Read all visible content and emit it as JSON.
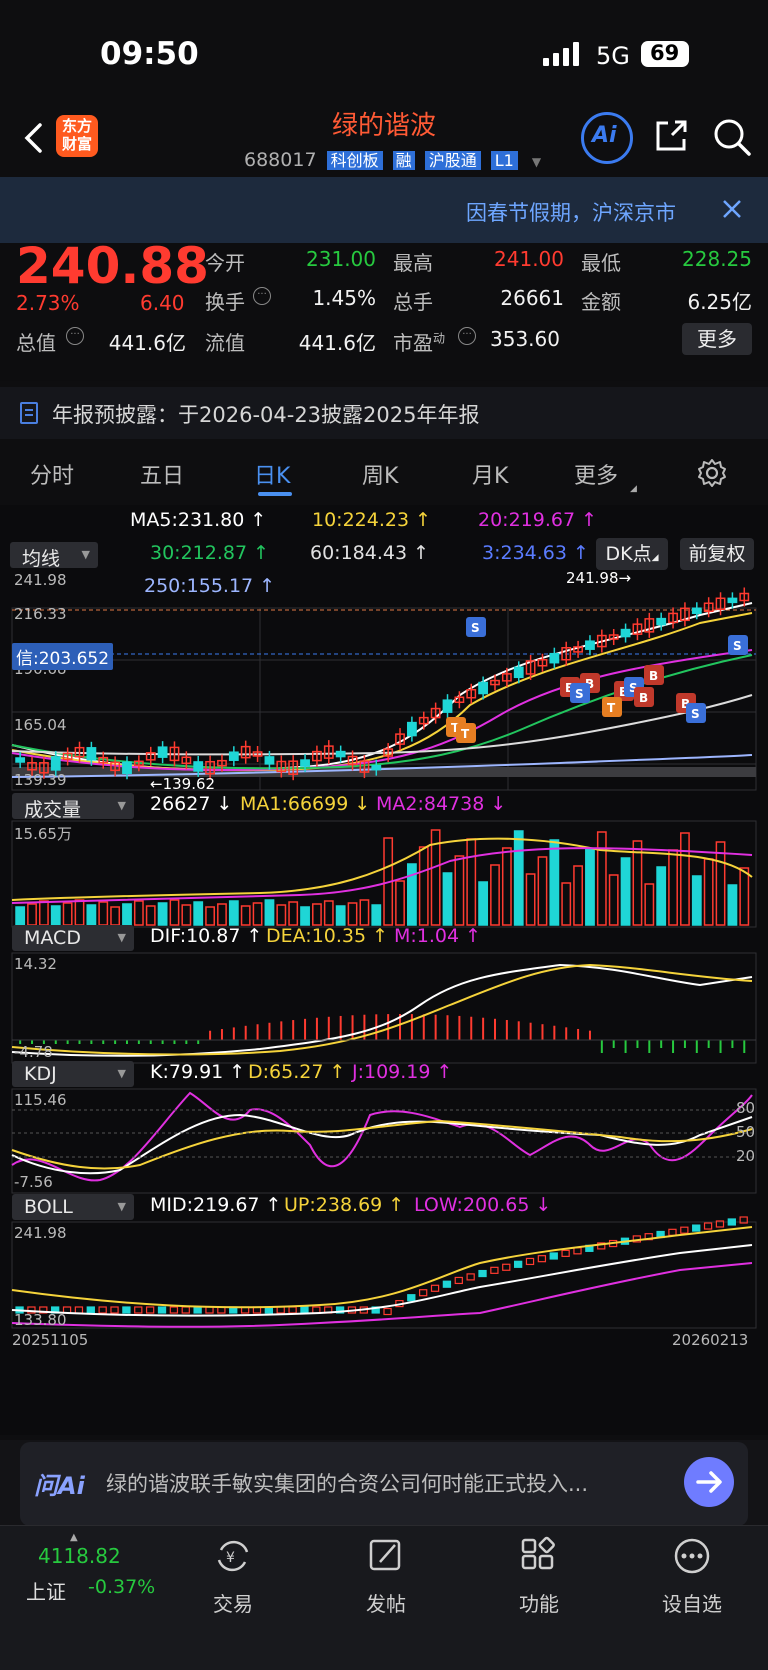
{
  "status": {
    "time": "09:50",
    "network": "5G",
    "battery": "69"
  },
  "header": {
    "logo": "东方财富",
    "title": "绿的谐波",
    "code": "688017",
    "tags": [
      "科创板",
      "融",
      "沪股通",
      "L1"
    ],
    "ai_label": "Ai"
  },
  "banner": {
    "text": "因春节假期，沪深京市"
  },
  "quote": {
    "price": "240.88",
    "change_pct": "2.73%",
    "change": "6.40",
    "open_label": "今开",
    "open": "231.00",
    "high_label": "最高",
    "high": "241.00",
    "low_label": "最低",
    "low": "228.25",
    "turnover_label": "换手",
    "turnover": "1.45%",
    "volume_label": "总手",
    "volume": "26661",
    "amount_label": "金额",
    "amount": "6.25亿",
    "mktcap_label": "总值",
    "mktcap": "441.6亿",
    "float_label": "流值",
    "float": "441.6亿",
    "pe_label": "市盈",
    "pe_sup": "动",
    "pe": "353.60",
    "more": "更多"
  },
  "notice": {
    "text": "年报预披露：于2026-04-23披露2025年年报"
  },
  "tabs": [
    "分时",
    "五日",
    "日K",
    "周K",
    "月K",
    "更多"
  ],
  "active_tab": "日K",
  "ma": {
    "selector": "均线",
    "ma5": "MA5:231.80",
    "ma10": "10:224.23",
    "ma20": "20:219.67",
    "ma30": "30:212.87",
    "ma60": "60:184.43",
    "ma3": "3:234.63",
    "ma250": "250:155.17",
    "dk": "DK点",
    "fq": "前复权"
  },
  "kline": {
    "y_labels": [
      "241.98",
      "216.33",
      "190.68",
      "165.04",
      "139.39"
    ],
    "max_marker": "241.98",
    "min_marker": "139.62",
    "cursor_label": "信:203.652"
  },
  "volume": {
    "selector": "成交量",
    "v": "26627",
    "ma1": "MA1:66699",
    "ma2": "MA2:84738",
    "max": "15.65万"
  },
  "macd": {
    "selector": "MACD",
    "dif": "DIF:10.87",
    "dea": "DEA:10.35",
    "m": "M:1.04",
    "top": "14.32",
    "bottom": "-4.78"
  },
  "kdj": {
    "selector": "KDJ",
    "k": "K:79.91",
    "d": "D:65.27",
    "j": "J:109.19",
    "top": "115.46",
    "bottom": "-7.56",
    "r80": "80",
    "r50": "50",
    "r20": "20"
  },
  "boll": {
    "selector": "BOLL",
    "mid": "MID:219.67",
    "up": "UP:238.69",
    "low": "LOW:200.65",
    "top": "241.98",
    "bottom": "133.80"
  },
  "dates": {
    "start": "20251105",
    "end": "20260213"
  },
  "ai": {
    "brand": "问Ai",
    "question": "绿的谐波联手敏实集团的合资公司何时能正式投入..."
  },
  "index": {
    "value": "4118.82",
    "name": "上证",
    "change": "-0.37%"
  },
  "tabbar": [
    "交易",
    "发帖",
    "功能",
    "设自选"
  ],
  "colors": {
    "up": "#ff3b30",
    "down": "#1fd6d6",
    "ma5": "#ffffff",
    "ma10": "#f5d33b",
    "ma20": "#e030e0",
    "ma30": "#22c55e",
    "ma60": "#dcdcdc",
    "ma250": "#9db6ff"
  }
}
